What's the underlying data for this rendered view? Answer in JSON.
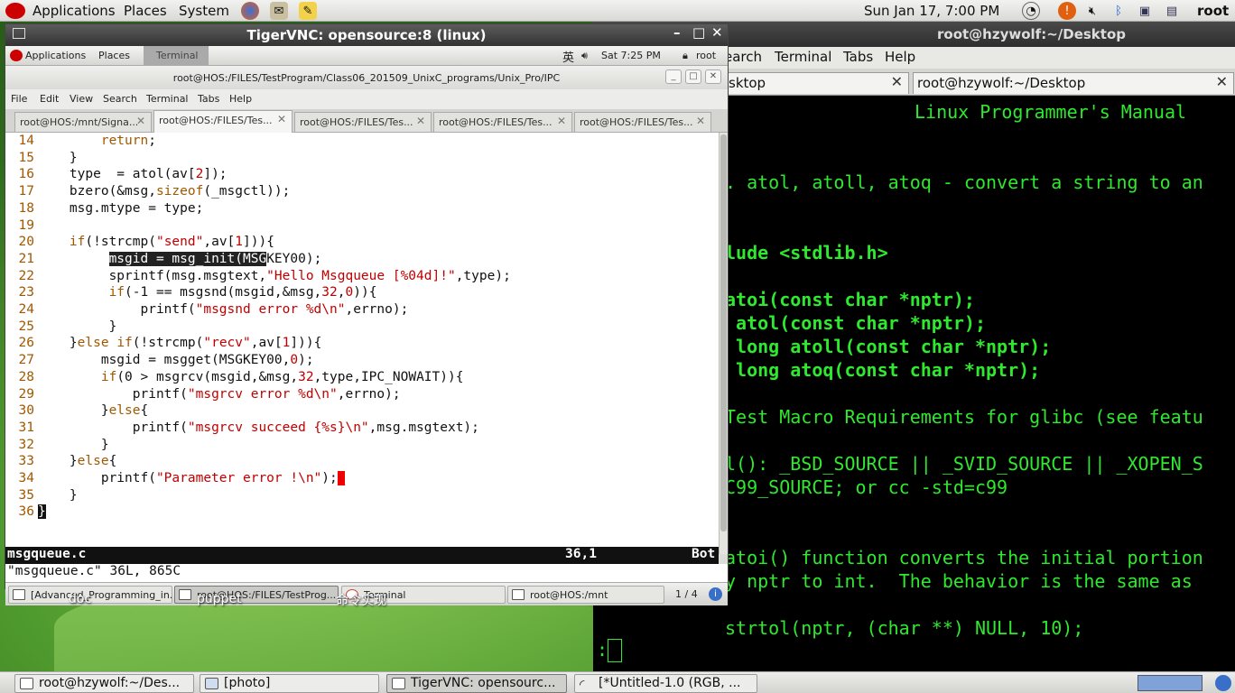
{
  "top_panel": {
    "menus": [
      "Applications",
      "Places",
      "System"
    ],
    "clock": "Sun Jan 17,  7:00 PM",
    "user": "root"
  },
  "right_terminal": {
    "title": "root@hzywolf:~/Desktop",
    "menu": [
      "earch",
      "Terminal",
      "Tabs",
      "Help"
    ],
    "tabs": [
      {
        "label": "sktop"
      },
      {
        "label": "root@hzywolf:~/Desktop"
      }
    ],
    "lines": [
      "Linux Programmer's Manual",
      ". atol, atoll, atoq - convert a string to an",
      "lude <stdlib.h>",
      "atoi(const char *nptr);",
      " atol(const char *nptr);",
      " long atoll(const char *nptr);",
      " long atoq(const char *nptr);",
      "Test Macro Requirements for glibc (see featu",
      "l(): _BSD_SOURCE || _SVID_SOURCE || _XOPEN_S",
      "C99_SOURCE; or cc -std=c99",
      "atoi() function converts the initial portion",
      "y nptr to int.  The behavior is the same as",
      "strtol(nptr, (char **) NULL, 10);"
    ],
    "prompt": ":"
  },
  "vnc": {
    "title": "TigerVNC: opensource:8 (linux)",
    "inner_panel": {
      "menus": [
        "Applications",
        "Places"
      ],
      "terminal_label": "Terminal",
      "ime": "英",
      "clock": "Sat  7:25 PM",
      "user": "root"
    },
    "window_title": "root@HOS:/FILES/TestProgram/Class06_201509_UnixC_programs/Unix_Pro/IPC",
    "menu": [
      "File",
      "Edit",
      "View",
      "Search",
      "Terminal",
      "Tabs",
      "Help"
    ],
    "tabs": [
      {
        "label": "root@HOS:/mnt/Signa..."
      },
      {
        "label": "root@HOS:/FILES/Tes..."
      },
      {
        "label": "root@HOS:/FILES/Tes..."
      },
      {
        "label": "root@HOS:/FILES/Tes..."
      },
      {
        "label": "root@HOS:/FILES/Tes..."
      }
    ],
    "code_lines": [
      {
        "n": "14",
        "text": "        return;"
      },
      {
        "n": "15",
        "text": "    }"
      },
      {
        "n": "16",
        "text": "    type  = atol(av[2]);"
      },
      {
        "n": "17",
        "text": "    bzero(&msg,sizeof(_msgctl));"
      },
      {
        "n": "18",
        "text": "    msg.mtype = type;"
      },
      {
        "n": "19",
        "text": ""
      },
      {
        "n": "20",
        "text": "    if(!strcmp(\"send\",av[1])){"
      },
      {
        "n": "21",
        "text": "         msgid = msg_init(MSGKEY00);"
      },
      {
        "n": "22",
        "text": "         sprintf(msg.msgtext,\"Hello Msgqueue [%04d]!\",type);"
      },
      {
        "n": "23",
        "text": "         if(-1 == msgsnd(msgid,&msg,32,0)){"
      },
      {
        "n": "24",
        "text": "             printf(\"msgsnd error %d\\n\",errno);"
      },
      {
        "n": "25",
        "text": "         }"
      },
      {
        "n": "26",
        "text": "    }else if(!strcmp(\"recv\",av[1])){"
      },
      {
        "n": "27",
        "text": "        msgid = msgget(MSGKEY00,0);"
      },
      {
        "n": "28",
        "text": "        if(0 > msgrcv(msgid,&msg,32,type,IPC_NOWAIT)){"
      },
      {
        "n": "29",
        "text": "            printf(\"msgrcv error %d\\n\",errno);"
      },
      {
        "n": "30",
        "text": "        }else{"
      },
      {
        "n": "31",
        "text": "            printf(\"msgrcv succeed {%s}\\n\",msg.msgtext);"
      },
      {
        "n": "32",
        "text": "        }"
      },
      {
        "n": "33",
        "text": "    }else{"
      },
      {
        "n": "34",
        "text": "        printf(\"Parameter error !\\n\");"
      },
      {
        "n": "35",
        "text": "    }"
      },
      {
        "n": "36",
        "text": "}"
      }
    ],
    "status_file": "msgqueue.c",
    "status_pos": "36,1",
    "status_scroll": "Bot",
    "cmdline": "\"msgqueue.c\" 36L, 865C",
    "taskbar": [
      {
        "label": "[Advanced_Programming_in..."
      },
      {
        "label": "root@HOS:/FILES/TestProg..."
      },
      {
        "label": "Terminal"
      },
      {
        "label": "root@HOS:/mnt"
      }
    ],
    "workspace": "1 / 4"
  },
  "desktop_icons": [
    "doc",
    "puppet",
    "命令实现"
  ],
  "bottom_panel": {
    "tasks": [
      {
        "label": "root@hzywolf:~/Des..."
      },
      {
        "label": "[photo]"
      },
      {
        "label": "TigerVNC: opensourc..."
      },
      {
        "label": "[*Untitled-1.0 (RGB, ..."
      }
    ]
  }
}
